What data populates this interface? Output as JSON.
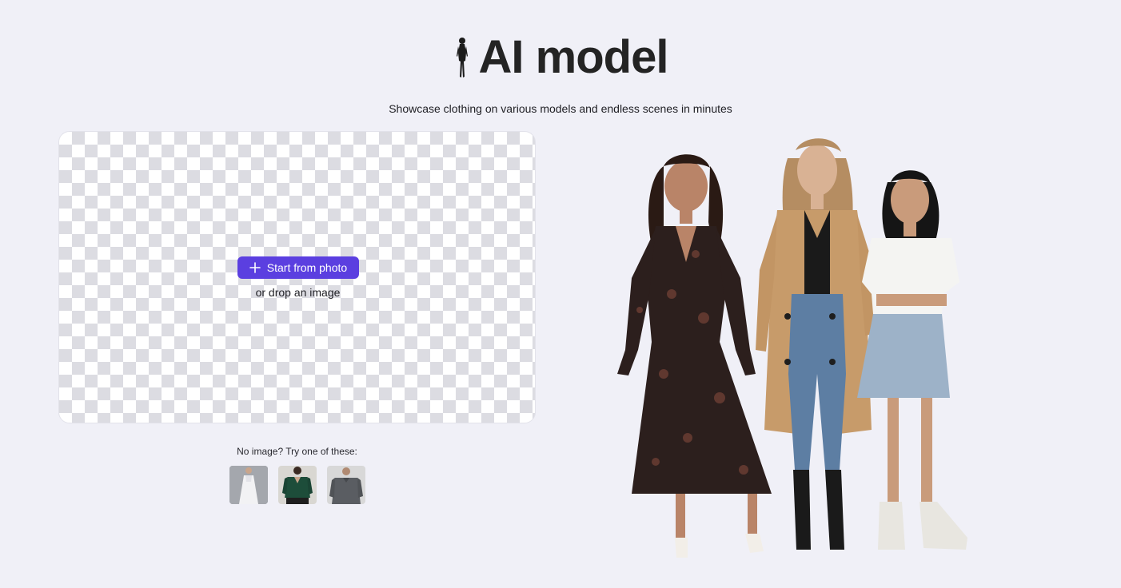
{
  "header": {
    "title": "AI model",
    "title_icon": "woman-silhouette-icon",
    "subtitle": "Showcase clothing on various models and endless scenes in minutes"
  },
  "upload": {
    "button_label": "Start from photo",
    "button_icon": "plus-icon",
    "drop_text": "or drop an image"
  },
  "samples": {
    "label": "No image? Try one of these:",
    "items": [
      {
        "name": "white-dress-sample"
      },
      {
        "name": "green-sweater-sample"
      },
      {
        "name": "grey-sweater-sample"
      }
    ]
  },
  "colors": {
    "background": "#f0f0f7",
    "accent": "#5b3fe0",
    "title": "#242424"
  }
}
